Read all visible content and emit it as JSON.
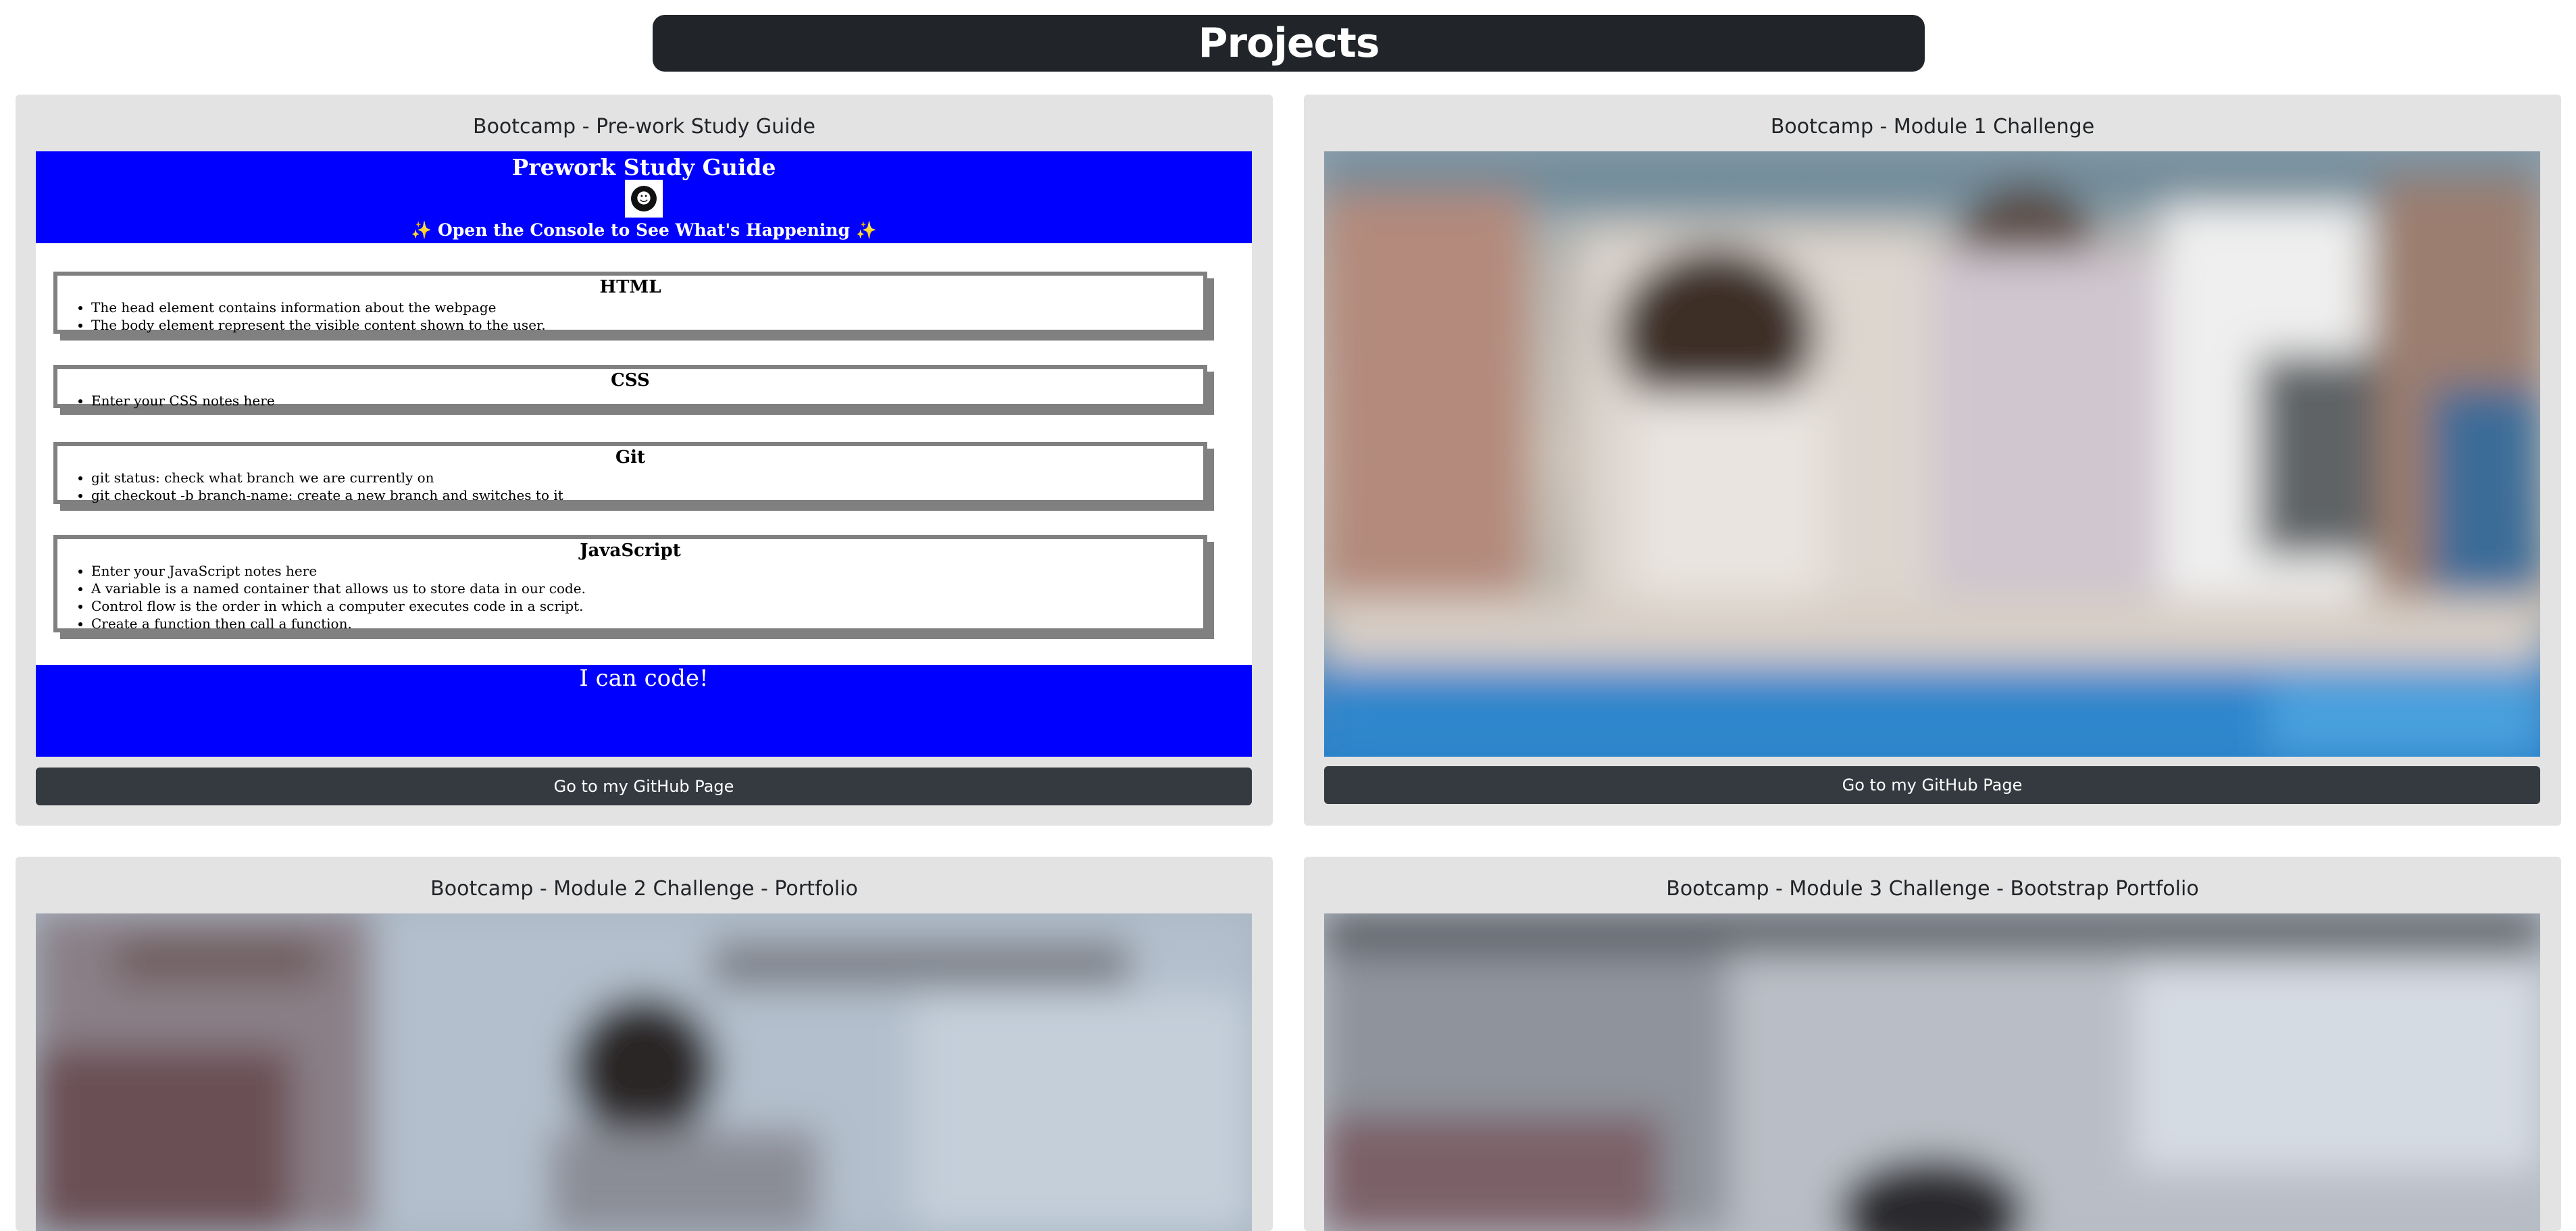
{
  "header": {
    "title": "Projects"
  },
  "projects": [
    {
      "title": "Bootcamp - Pre-work Study Guide",
      "button_label": "Go to my GitHub Page"
    },
    {
      "title": "Bootcamp - Module 1 Challenge",
      "button_label": "Go to my GitHub Page"
    },
    {
      "title": "Bootcamp - Module 2 Challenge - Portfolio"
    },
    {
      "title": "Bootcamp - Module 3 Challenge - Bootstrap Portfolio"
    }
  ],
  "prework_preview": {
    "title": "Prework Study Guide",
    "console_message": "✨ Open the Console to See What's Happening ✨",
    "sections": [
      {
        "heading": "HTML",
        "items": [
          "The head element contains information about the webpage",
          "The body element represent the visible content shown to the user."
        ]
      },
      {
        "heading": "CSS",
        "items": [
          "Enter your CSS notes here"
        ]
      },
      {
        "heading": "Git",
        "items": [
          "git status: check what branch we are currently on",
          "git checkout -b branch-name: create a new branch and switches to it"
        ]
      },
      {
        "heading": "JavaScript",
        "items": [
          "Enter your JavaScript notes here",
          "A variable is a named container that allows us to store data in our code.",
          "Control flow is the order in which a computer executes code in a script.",
          "Create a function then call a function."
        ]
      }
    ],
    "footer_text": "I can code!"
  }
}
